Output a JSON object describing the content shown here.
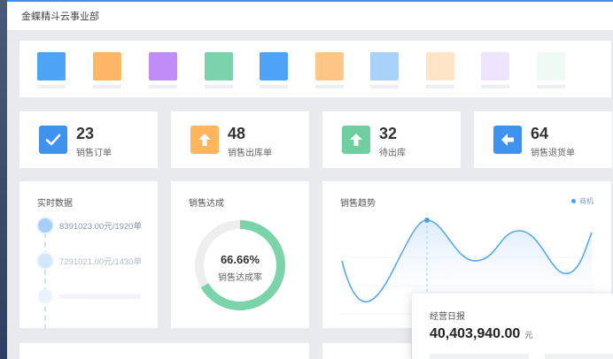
{
  "header": {
    "title": "金蝶精斗云事业部"
  },
  "shortcuts": [
    {
      "color": "#4da3f5"
    },
    {
      "color": "#ffb765"
    },
    {
      "color": "#c08cf7"
    },
    {
      "color": "#7ad3ad"
    },
    {
      "color": "#4da3f5"
    },
    {
      "color": "#ffc685"
    },
    {
      "color": "#a9d2fb"
    },
    {
      "color": "#fee5c7"
    },
    {
      "color": "#efe4fd"
    },
    {
      "color": "#eefaf3"
    }
  ],
  "stats": [
    {
      "value": "23",
      "label": "销售订单",
      "icon": "check-icon",
      "color": "#3f93ef"
    },
    {
      "value": "48",
      "label": "销售出库单",
      "icon": "arrow-up-icon",
      "color": "#ffb45e"
    },
    {
      "value": "32",
      "label": "待出库",
      "icon": "arrow-up-icon",
      "color": "#6fcf9e"
    },
    {
      "value": "64",
      "label": "销售退货单",
      "icon": "arrow-left-icon",
      "color": "#3f93ef"
    }
  ],
  "realtime": {
    "title": "实时数据",
    "items": [
      {
        "text": "8391023.00元/1920单",
        "color": "#8a95a8"
      },
      {
        "text": "7291021.00元/1430单",
        "color": "#b4bccb"
      }
    ]
  },
  "target": {
    "title": "销售达成",
    "percent_text": "66.66%",
    "percent": 66.66,
    "label": "销售达成率",
    "color": "#7bd3a9"
  },
  "trend": {
    "title": "销售趋势",
    "legend": "商机"
  },
  "daily": {
    "title": "经营日报",
    "value": "40,403,940.00",
    "unit": "元"
  }
}
